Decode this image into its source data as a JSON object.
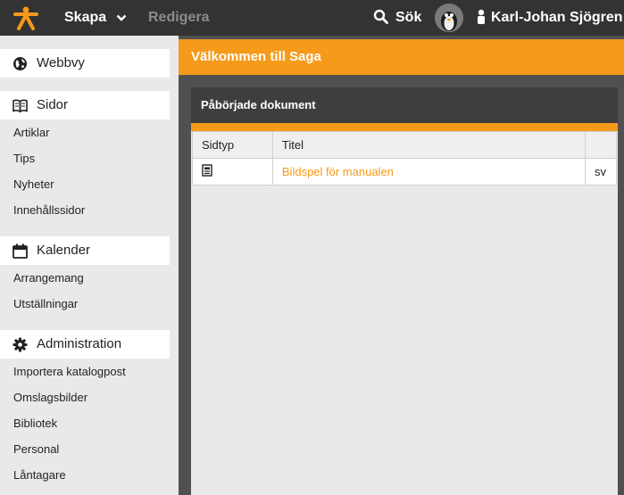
{
  "topbar": {
    "create_label": "Skapa",
    "edit_label": "Redigera",
    "search_label": "Sök",
    "user_name": "Karl-Johan Sjögren"
  },
  "sidebar": {
    "sections": [
      {
        "label": "Webbvy",
        "icon": "globe-icon",
        "items": []
      },
      {
        "label": "Sidor",
        "icon": "book-icon",
        "items": [
          "Artiklar",
          "Tips",
          "Nyheter",
          "Innehållssidor"
        ]
      },
      {
        "label": "Kalender",
        "icon": "calendar-icon",
        "items": [
          "Arrangemang",
          "Utställningar"
        ]
      },
      {
        "label": "Administration",
        "icon": "gear-icon",
        "items": [
          "Importera katalogpost",
          "Omslagsbilder",
          "Bibliotek",
          "Personal",
          "Låntagare"
        ]
      }
    ]
  },
  "main": {
    "welcome": "Välkommen till Saga",
    "panel_title": "Påbörjade dokument",
    "table": {
      "headers": [
        "Sidtyp",
        "Titel",
        ""
      ],
      "rows": [
        {
          "icon": "document-icon",
          "title": "Bildspel för manualen",
          "lang": "sv"
        }
      ]
    }
  },
  "colors": {
    "accent": "#f59a1b",
    "topbar": "#333333",
    "panel_header": "#3e3e3e"
  }
}
